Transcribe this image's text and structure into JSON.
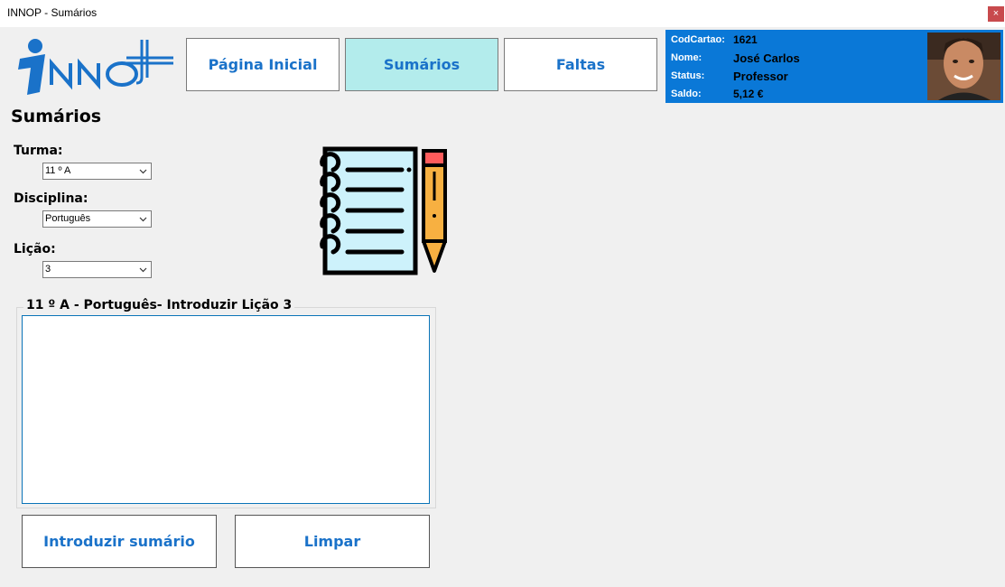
{
  "window": {
    "title": "INNOP - Sumários",
    "close_label": "×"
  },
  "nav": {
    "home": "Página Inicial",
    "summaries": "Sumários",
    "absences": "Faltas"
  },
  "user": {
    "card_label": "CodCartao:",
    "card_value": "1621",
    "name_label": "Nome:",
    "name_value": "José Carlos",
    "status_label": "Status:",
    "status_value": "Professor",
    "balance_label": "Saldo:",
    "balance_value": "5,12 €"
  },
  "page": {
    "title": "Sumários"
  },
  "form": {
    "class_label": "Turma:",
    "class_value": "11 º A",
    "subject_label": "Disciplina:",
    "subject_value": "Português",
    "lesson_label": "Lição:",
    "lesson_value": "3"
  },
  "summary": {
    "group_title": "11 º A - Português- Introduzir Lição 3",
    "text": ""
  },
  "actions": {
    "submit": "Introduzir sumário",
    "clear": "Limpar"
  },
  "colors": {
    "accent": "#1a72c9",
    "panel": "#0a78d7",
    "active_tab": "#b3ecec",
    "close": "#c84a4d"
  },
  "icons": {
    "logo": "inno-logo",
    "notebook": "notebook-pencil-icon",
    "chevron": "chevron-down-icon"
  }
}
